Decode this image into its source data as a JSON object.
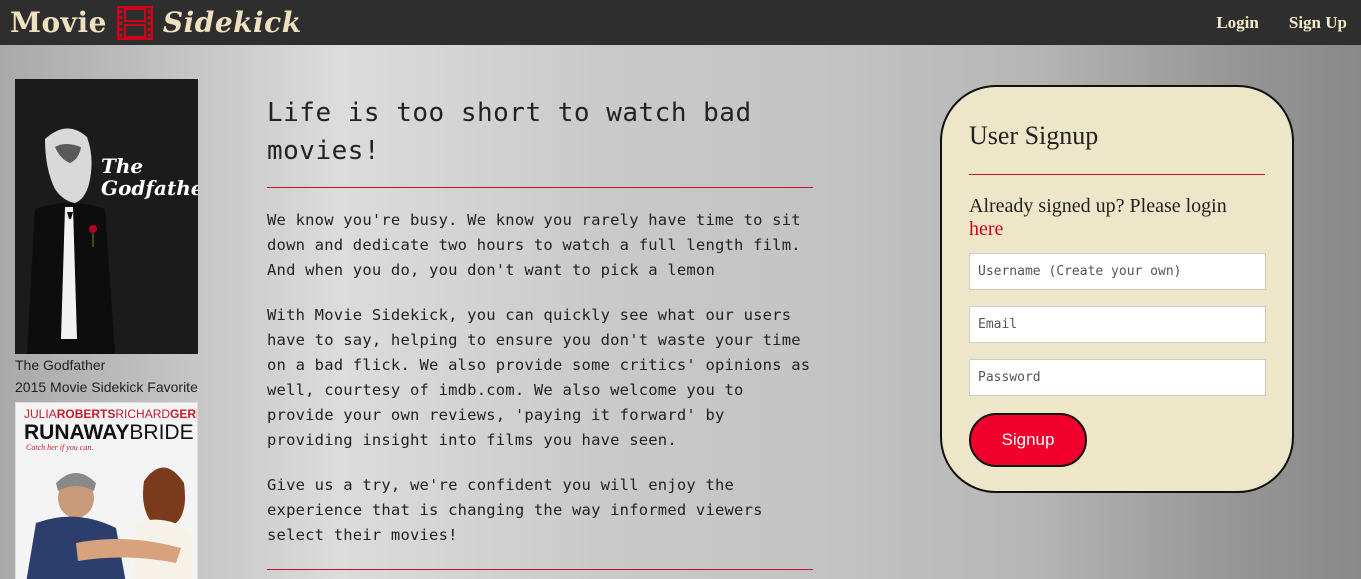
{
  "nav": {
    "brand_part1": "Movie",
    "brand_part2": "Sidekick",
    "brand_icon": "film-strip-icon",
    "login_label": "Login",
    "signup_label": "Sign Up"
  },
  "posters": [
    {
      "title_art": "The Godfather",
      "caption_line1": "The Godfather",
      "caption_line2": "2015 Movie Sidekick Favorite"
    },
    {
      "top_line_a": "JULIA",
      "top_line_b": "ROBERTS",
      "top_line_c": "RICHARD",
      "top_line_d": "GERE",
      "title_a": "RUNAWAY",
      "title_b": "BRIDE",
      "tagline": "Catch her if you can."
    }
  ],
  "main": {
    "headline": "Life is too short to watch bad movies!",
    "paragraphs": [
      "We know you're busy. We know you rarely have time to sit down and dedicate two hours to watch a full length film. And when you do, you don't want to pick a lemon",
      "With Movie Sidekick, you can quickly see what our users have to say, helping to ensure you don't waste your time on a bad flick. We also provide some critics' opinions as well, courtesy of imdb.com. We also welcome you to provide your own reviews, 'paying it forward' by providing insight into films you have seen.",
      "Give us a try, we're confident you will enjoy the experience that is changing the way informed viewers select their movies!"
    ]
  },
  "signup": {
    "title": "User Signup",
    "already_text": "Already signed up? Please login ",
    "here_link": "here",
    "username_placeholder": "Username (Create your own)",
    "email_placeholder": "Email",
    "password_placeholder": "Password",
    "button_label": "Signup"
  },
  "colors": {
    "accent": "#f0002a",
    "rule": "#c7102e",
    "navbar": "#2e2e2e",
    "card": "#ede6c9"
  }
}
